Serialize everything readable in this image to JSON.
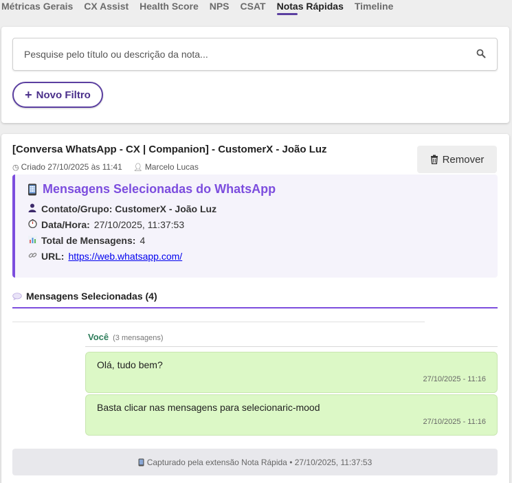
{
  "tabs": [
    {
      "label": "Métricas Gerais"
    },
    {
      "label": "CX Assist"
    },
    {
      "label": "Health Score"
    },
    {
      "label": "NPS"
    },
    {
      "label": "CSAT"
    },
    {
      "label": "Notas Rápidas",
      "active": true
    },
    {
      "label": "Timeline"
    }
  ],
  "search": {
    "placeholder": "Pesquise pelo título ou descrição da nota...",
    "value": ""
  },
  "filter": {
    "label": "Novo Filtro"
  },
  "note": {
    "title": "[Conversa WhatsApp - CX | Companion] - CustomerX - João Luz",
    "created": "Criado 27/10/2025 às 11:41",
    "author": "Marcelo Lucas",
    "remove_label": "Remover",
    "info": {
      "title": "Mensagens Selecionadas do WhatsApp",
      "contact_label": "Contato/Grupo: CustomerX - João Luz",
      "datetime_label": "Data/Hora:",
      "datetime_value": "27/10/2025, 11:37:53",
      "total_label": "Total de Mensagens:",
      "total_value": "4",
      "url_label": "URL:",
      "url_value": "https://web.whatsapp.com/"
    },
    "selected_header": "Mensagens Selecionadas (4)",
    "sender": {
      "name": "Você",
      "count": "(3 mensagens)"
    },
    "messages": [
      {
        "text": "Olá, tudo bem?",
        "time": "27/10/2025 - 11:16"
      },
      {
        "text": "Basta clicar nas mensagens para selecionaric-mood",
        "time": "27/10/2025 - 11:16"
      }
    ],
    "footer": "Capturado pela extensão Nota Rápida • 27/10/2025, 11:37:53"
  },
  "colors": {
    "accent": "#5b3fa0",
    "info_title": "#7c4dde",
    "bubble": "#dcf8c6",
    "sender": "#2e7d5b"
  }
}
